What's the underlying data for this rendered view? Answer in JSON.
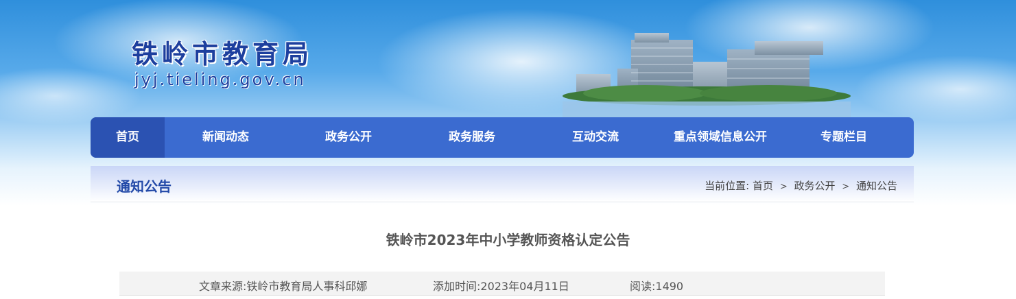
{
  "header": {
    "site_name": "铁岭市教育局",
    "site_url": "jyj.tieling.gov.cn"
  },
  "nav": {
    "items": [
      {
        "label": "首页",
        "active": true
      },
      {
        "label": "新闻动态",
        "active": false
      },
      {
        "label": "政务公开",
        "active": false
      },
      {
        "label": "政务服务",
        "active": false
      },
      {
        "label": "互动交流",
        "active": false
      },
      {
        "label": "重点领域信息公开",
        "active": false
      },
      {
        "label": "专题栏目",
        "active": false
      }
    ]
  },
  "section": {
    "title": "通知公告",
    "breadcrumb_prefix": "当前位置:",
    "breadcrumb": [
      "首页",
      "政务公开",
      "通知公告"
    ],
    "separator": ">"
  },
  "article": {
    "title": "铁岭市2023年中小学教师资格认定公告",
    "source": "文章来源:铁岭市教育局人事科邱娜",
    "added": "添加时间:2023年04月11日",
    "views": "阅读:1490"
  },
  "colors": {
    "nav_bg": "#3b6bd0",
    "nav_active": "#2b52b2",
    "section_title": "#2249a8"
  }
}
